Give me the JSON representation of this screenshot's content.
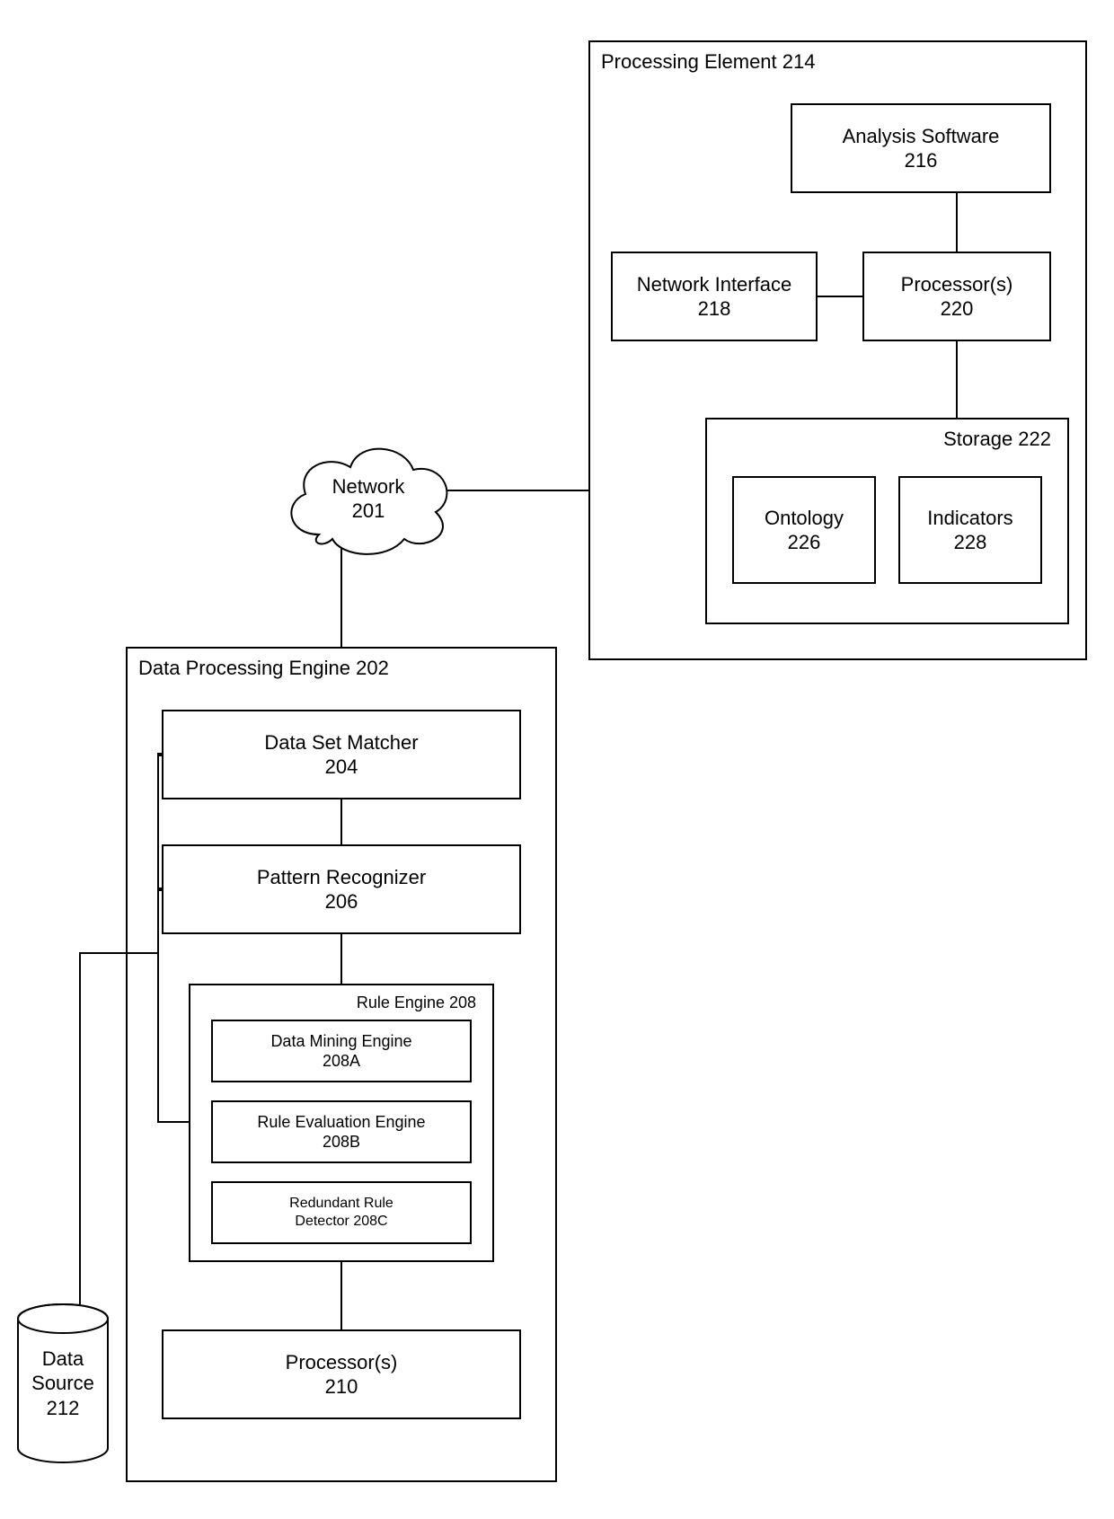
{
  "dpe": {
    "title": "Data Processing Engine 202",
    "matcher": {
      "name": "Data Set Matcher",
      "ref": "204"
    },
    "recognizer": {
      "name": "Pattern Recognizer",
      "ref": "206"
    },
    "ruleEngine": {
      "title": "Rule Engine 208",
      "mining": {
        "name": "Data Mining Engine",
        "ref": "208A"
      },
      "eval": {
        "name": "Rule Evaluation Engine",
        "ref": "208B"
      },
      "redundant": {
        "name": "Redundant Rule",
        "ref": "Detector 208C"
      }
    },
    "processors": {
      "name": "Processor(s)",
      "ref": "210"
    }
  },
  "dataSource": {
    "name": "Data",
    "name2": "Source",
    "ref": "212"
  },
  "network": {
    "name": "Network",
    "ref": "201"
  },
  "pe": {
    "title": "Processing Element 214",
    "analysis": {
      "name": "Analysis Software",
      "ref": "216"
    },
    "netif": {
      "name": "Network Interface",
      "ref": "218"
    },
    "processors": {
      "name": "Processor(s)",
      "ref": "220"
    },
    "storage": {
      "title": "Storage 222",
      "ontology": {
        "name": "Ontology",
        "ref": "226"
      },
      "indicators": {
        "name": "Indicators",
        "ref": "228"
      }
    }
  }
}
